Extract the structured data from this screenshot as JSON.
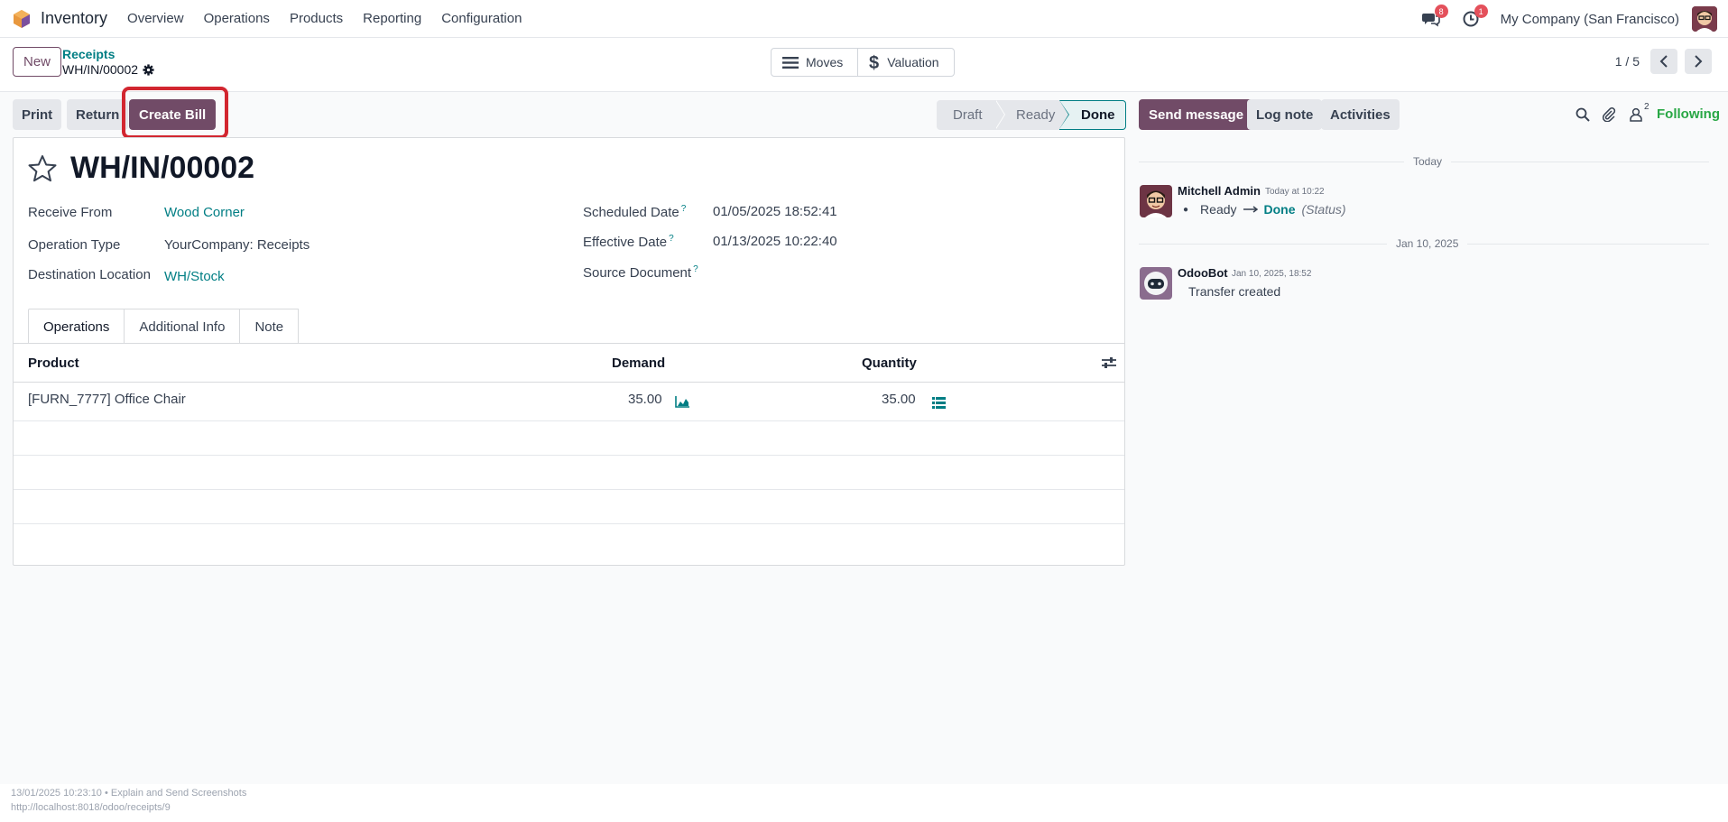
{
  "navbar": {
    "app_name": "Inventory",
    "menu": [
      "Overview",
      "Operations",
      "Products",
      "Reporting",
      "Configuration"
    ],
    "messages_count": "8",
    "activities_count": "1",
    "company": "My Company (San Francisco)"
  },
  "control_panel": {
    "new_label": "New",
    "breadcrumb_parent": "Receipts",
    "breadcrumb_current": "WH/IN/00002",
    "smart_moves": "Moves",
    "smart_valuation": "Valuation",
    "pager_value": "1 / 5"
  },
  "actions": {
    "print": "Print",
    "return": "Return",
    "create_bill": "Create Bill"
  },
  "status_stages": [
    "Draft",
    "Ready",
    "Done"
  ],
  "form": {
    "title": "WH/IN/00002",
    "receive_from_label": "Receive From",
    "receive_from_value": "Wood Corner",
    "operation_type_label": "Operation Type",
    "operation_type_value": "YourCompany: Receipts",
    "destination_label": "Destination Location",
    "destination_value": "WH/Stock",
    "scheduled_label": "Scheduled Date",
    "scheduled_value": "01/05/2025 18:52:41",
    "effective_label": "Effective Date",
    "effective_value": "01/13/2025 10:22:40",
    "source_doc_label": "Source Document",
    "help_mark": "?",
    "tabs": [
      "Operations",
      "Additional Info",
      "Note"
    ],
    "columns": {
      "product": "Product",
      "demand": "Demand",
      "quantity": "Quantity"
    },
    "rows": [
      {
        "product": "[FURN_7777] Office Chair",
        "demand": "35.00",
        "quantity": "35.00"
      }
    ]
  },
  "chatter": {
    "send_message": "Send message",
    "log_note": "Log note",
    "activities": "Activities",
    "followers_count": "2",
    "following": "Following",
    "sep_today": "Today",
    "sep_jan": "Jan 10, 2025",
    "messages": [
      {
        "author": "Mitchell Admin",
        "date": "Today at 10:22",
        "from": "Ready",
        "to": "Done",
        "field": "(Status)"
      },
      {
        "author": "OdooBot",
        "date": "Jan 10, 2025, 18:52",
        "body": "Transfer created"
      }
    ]
  },
  "footer": {
    "line1": "13/01/2025 10:23:10 • Explain and Send Screenshots",
    "line2": "http://localhost:8018/odoo/receipts/9"
  },
  "colors": {
    "brand": "#714b67",
    "link": "#017e84",
    "following": "#28a745",
    "highlight": "#d22630"
  }
}
